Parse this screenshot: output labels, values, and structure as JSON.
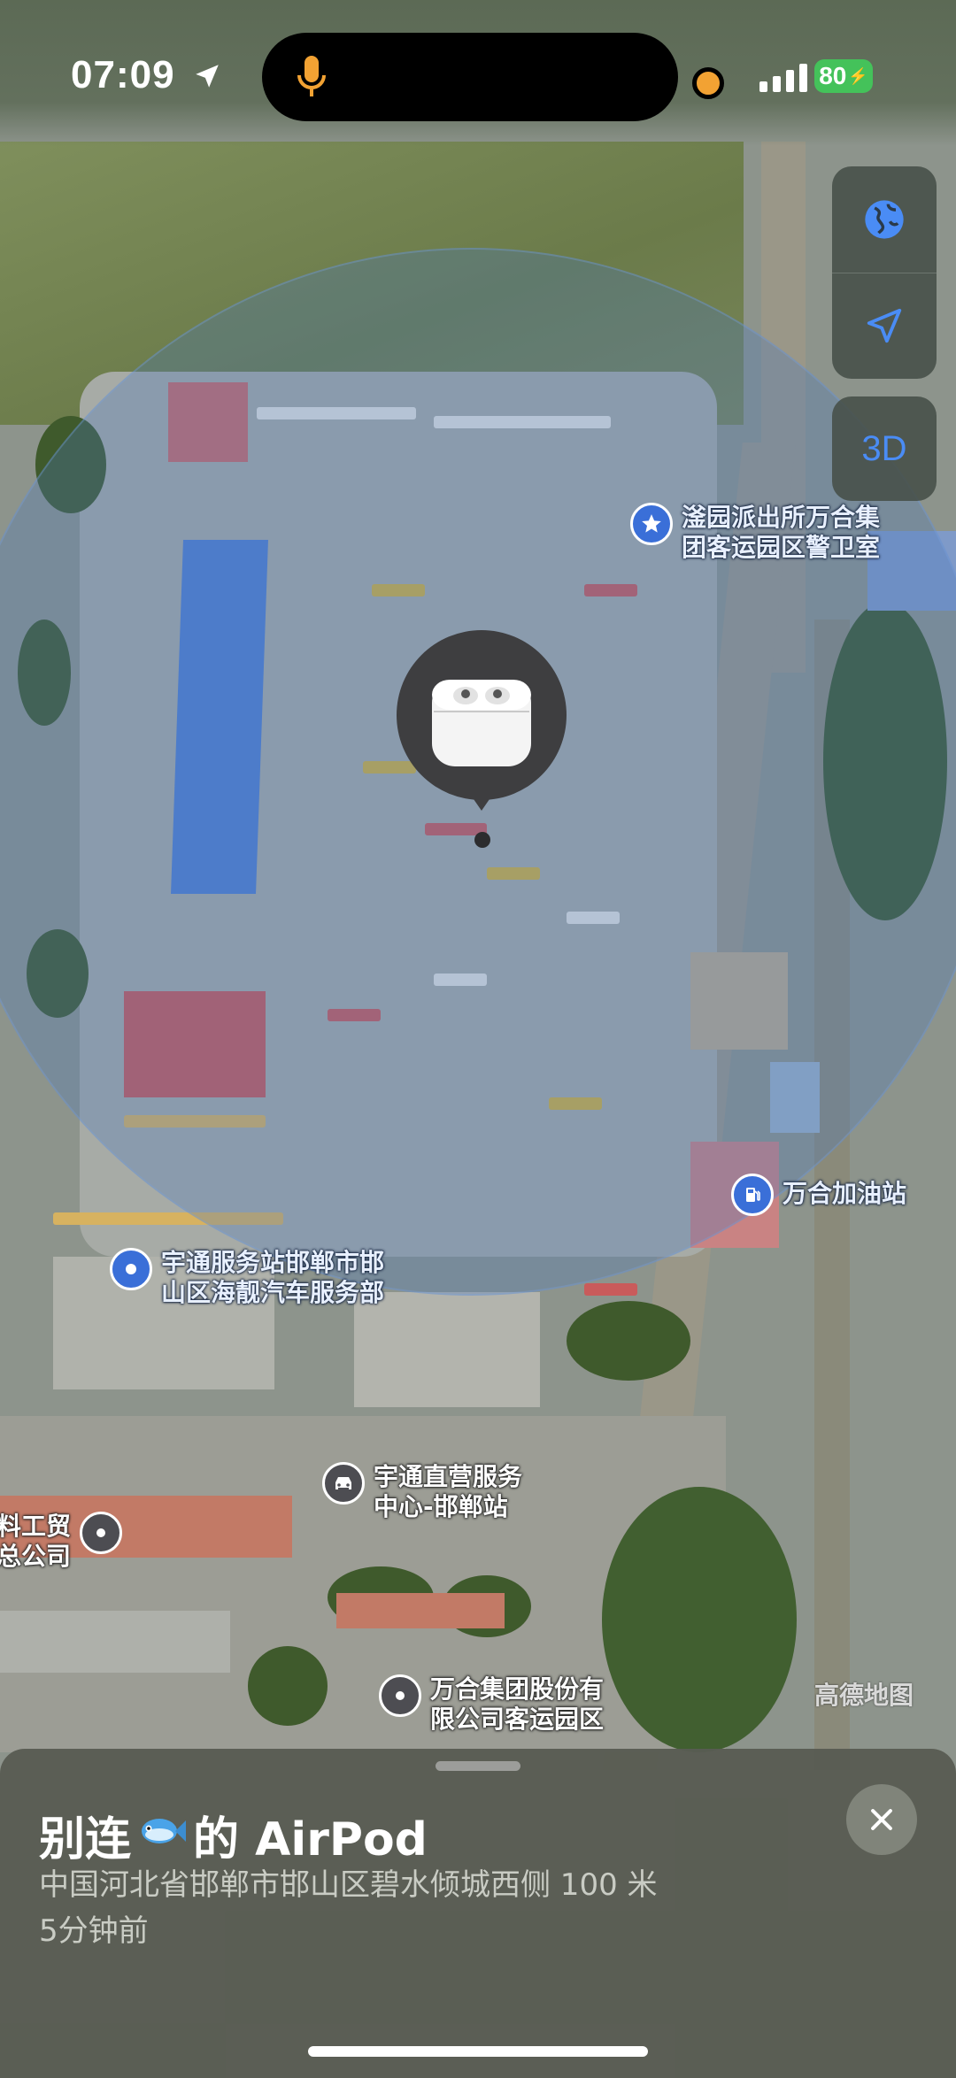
{
  "status_bar": {
    "time": "07:09",
    "battery": "80"
  },
  "map": {
    "labels": [
      {
        "id": "police",
        "text_line1": "滏园派出所万合集",
        "text_line2": "团客运园区警卫室",
        "icon": "star-icon"
      },
      {
        "id": "gas",
        "text_line1": "万合加油站",
        "icon": "gas-station-icon"
      },
      {
        "id": "service",
        "text_line1": "宇通服务站邯郸市邯",
        "text_line2": "山区海靓汽车服务部",
        "icon": "location-pin-icon"
      },
      {
        "id": "direct",
        "text_line1": "宇通直营服务",
        "text_line2": "中心-邯郸站",
        "icon": "car-icon"
      },
      {
        "id": "trade",
        "text_line1": "料工贸",
        "text_line2": "总公司",
        "icon": "location-pin-icon"
      },
      {
        "id": "wanhe",
        "text_line1": "万合集团股份有",
        "text_line2": "限公司客运园区",
        "icon": "location-pin-icon"
      }
    ],
    "watermark": "高德地图"
  },
  "controls": {
    "btn_3d": "3D"
  },
  "sheet": {
    "device_name_prefix": "别连",
    "device_name_suffix": "的 AirPod",
    "address": "中国河北省邯郸市邯山区碧水倾城西侧 100 米",
    "last_seen": "5分钟前"
  },
  "colors": {
    "accent": "#4a8cf5",
    "battery": "#44c25a",
    "location_dot": "#f2a233"
  }
}
